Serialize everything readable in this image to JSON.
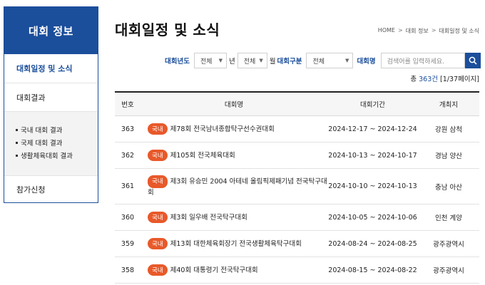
{
  "sidebar": {
    "title": "대회 정보",
    "items": [
      {
        "label": "대회일정 및 소식"
      },
      {
        "label": "대회결과"
      }
    ],
    "sub_items": [
      {
        "label": "국내 대회 결과"
      },
      {
        "label": "국제 대회 결과"
      },
      {
        "label": "생활체육대회 결과"
      }
    ],
    "last_item": {
      "label": "참가신청"
    }
  },
  "page": {
    "title": "대회일정 및 소식"
  },
  "breadcrumb": [
    "HOME",
    "대회 정보",
    "대회일정 및 소식"
  ],
  "filters": {
    "year_label": "대회년도",
    "year_value": "전체",
    "year_suffix": "년",
    "month_value": "전체",
    "month_suffix": "월",
    "category_label": "대회구분",
    "category_value": "전체",
    "name_label": "대회명",
    "search_placeholder": "검색어를 입력하세요."
  },
  "summary": {
    "prefix": "총",
    "count": "363건",
    "pages": "[1/37페이지]"
  },
  "table": {
    "headers": {
      "no": "번호",
      "name": "대회명",
      "period": "대회기간",
      "place": "개최지"
    },
    "rows": [
      {
        "no": "363",
        "badge": "국내",
        "name": "제78회 전국남녀종합탁구선수권대회",
        "period": "2024-12-17 ~ 2024-12-24",
        "place": "강원 삼척"
      },
      {
        "no": "362",
        "badge": "국내",
        "name": "제105회 전국체육대회",
        "period": "2024-10-13 ~ 2024-10-17",
        "place": "경남 양산"
      },
      {
        "no": "361",
        "badge": "국내",
        "name": "제3회 유승민 2004 아테네 올림픽제패기념 전국탁구대회",
        "period": "2024-10-10 ~ 2024-10-13",
        "place": "충남 아산"
      },
      {
        "no": "360",
        "badge": "국내",
        "name": "제3회 일우배 전국탁구대회",
        "period": "2024-10-05 ~ 2024-10-06",
        "place": "인천 계양"
      },
      {
        "no": "359",
        "badge": "국내",
        "name": "제13회 대한체육회장기 전국생활체육탁구대회",
        "period": "2024-08-24 ~ 2024-08-25",
        "place": "광주광역시"
      },
      {
        "no": "358",
        "badge": "국내",
        "name": "제40회 대통령기 전국탁구대회",
        "period": "2024-08-15 ~ 2024-08-22",
        "place": "광주광역시"
      }
    ]
  },
  "colors": {
    "primary": "#1b4e9b",
    "badge": "#e8592a"
  },
  "icons": {
    "search": "search-icon",
    "caret": "chevron-down-icon"
  }
}
